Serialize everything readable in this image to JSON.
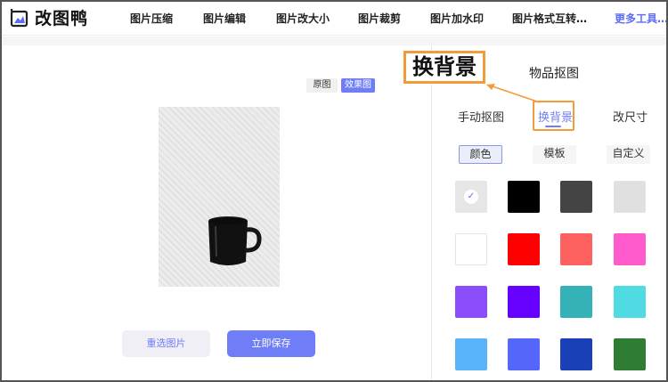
{
  "header": {
    "logo_text": "改图鸭",
    "nav": [
      "图片压缩",
      "图片编辑",
      "图片改大小",
      "图片裁剪",
      "图片加水印",
      "图片格式互转…",
      "更多工具…"
    ]
  },
  "canvas": {
    "toggle_original": "原图",
    "toggle_effect": "效果图",
    "reselect_label": "重选图片",
    "save_label": "立即保存"
  },
  "panel": {
    "title": "物品抠图",
    "tabs": [
      "手动抠图",
      "换背景",
      "改尺寸"
    ],
    "active_tab": "换背景",
    "subtabs": [
      "颜色",
      "模板",
      "自定义"
    ],
    "active_subtab": "颜色",
    "swatches": [
      "transparent",
      "#000000",
      "#444444",
      "#e0e0e0",
      "#ffffff",
      "#ff0000",
      "#ff6060",
      "#ff5bcd",
      "#8a4dfb",
      "#6600ff",
      "#35b2b8",
      "#4fdbe1",
      "#59b3fb",
      "#5566fb",
      "#1a40b8",
      "#2e7d32"
    ]
  },
  "callout": {
    "text": "换背景"
  },
  "colors": {
    "accent": "#6f7ef7",
    "callout": "#f39a3a"
  }
}
